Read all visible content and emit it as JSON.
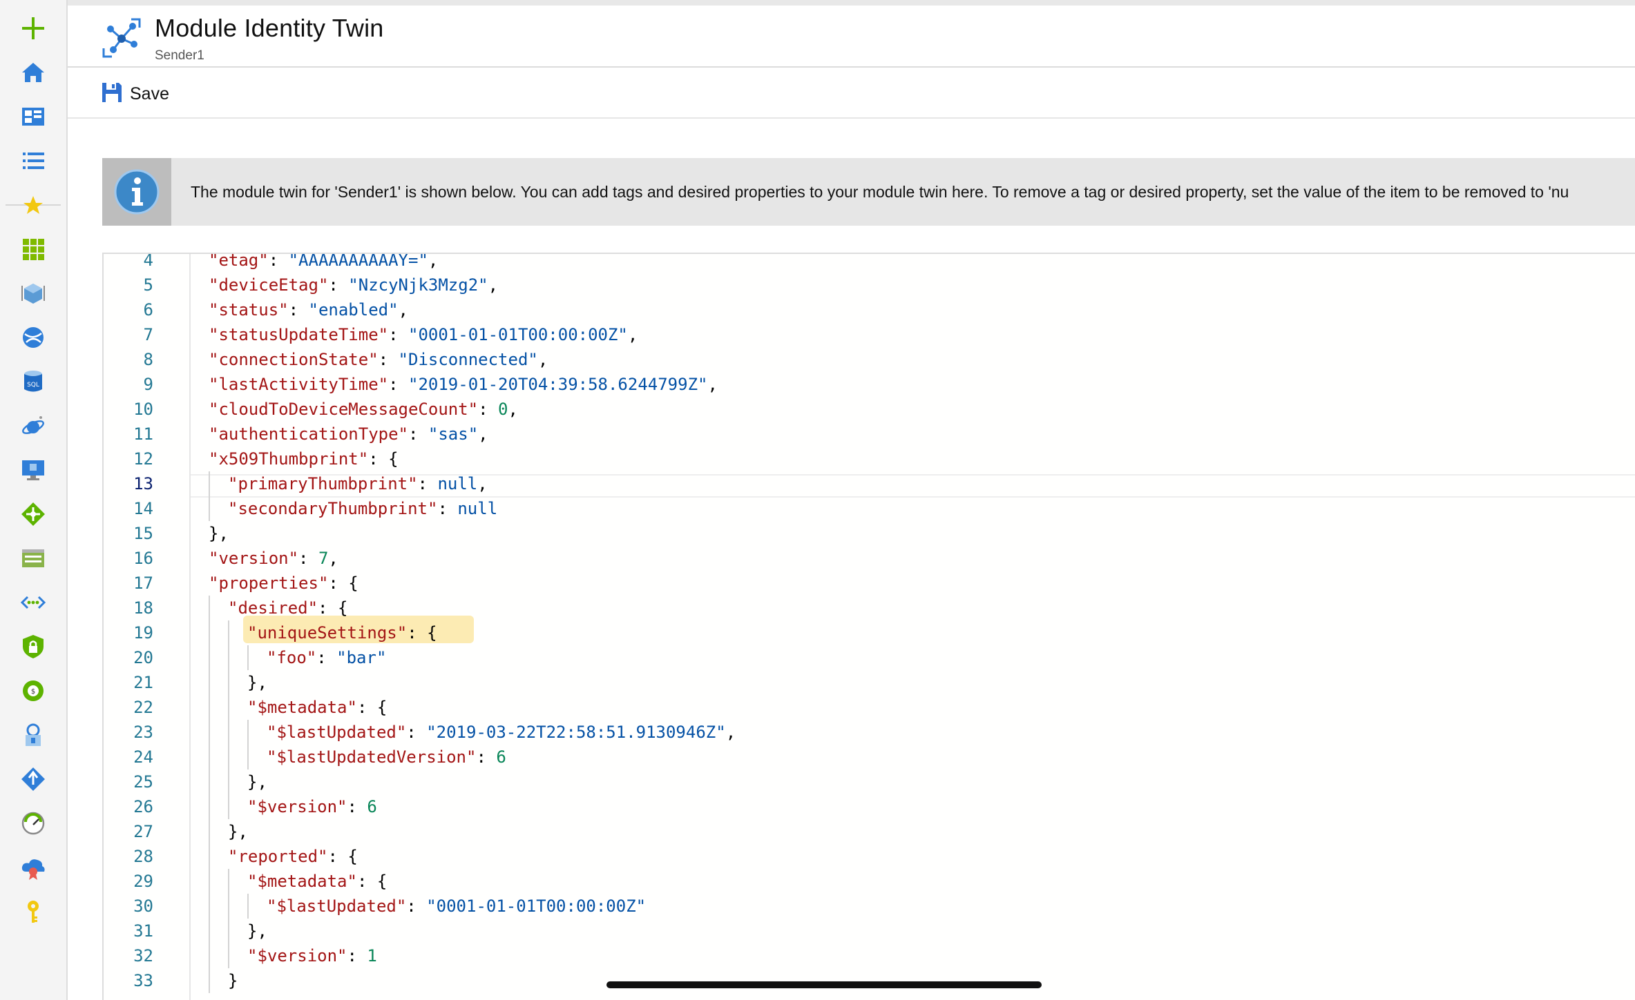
{
  "header": {
    "title": "Module Identity Twin",
    "subtitle": "Sender1"
  },
  "toolbar": {
    "save_label": "Save"
  },
  "info_banner": {
    "text": "The module twin for 'Sender1' is shown below. You can add tags and desired properties to your module twin here. To remove a tag or desired property, set the value of the item to be removed to 'nu"
  },
  "nav_icons": [
    "create-resource-icon",
    "home-icon",
    "dashboard-icon",
    "all-services-icon",
    "favorites-star-icon",
    "all-resources-icon",
    "resource-groups-icon",
    "app-services-icon",
    "sql-database-icon",
    "cosmos-db-icon",
    "virtual-machines-icon",
    "load-balancers-icon",
    "storage-accounts-icon",
    "virtual-networks-icon",
    "security-center-icon",
    "cost-management-icon",
    "azure-ad-icon",
    "monitor-icon",
    "advisor-icon",
    "cloud-icon",
    "key-vault-icon"
  ],
  "editor": {
    "active_line": "13",
    "lines": [
      {
        "n": "4",
        "indent": 0,
        "tokens": [
          {
            "t": "\"etag\"",
            "c": "k"
          },
          {
            "t": ": ",
            "c": "p"
          },
          {
            "t": "\"AAAAAAAAAAY=\"",
            "c": "s"
          },
          {
            "t": ",",
            "c": "p"
          }
        ]
      },
      {
        "n": "5",
        "indent": 0,
        "tokens": [
          {
            "t": "\"deviceEtag\"",
            "c": "k"
          },
          {
            "t": ": ",
            "c": "p"
          },
          {
            "t": "\"NzcyNjk3Mzg2\"",
            "c": "s"
          },
          {
            "t": ",",
            "c": "p"
          }
        ]
      },
      {
        "n": "6",
        "indent": 0,
        "tokens": [
          {
            "t": "\"status\"",
            "c": "k"
          },
          {
            "t": ": ",
            "c": "p"
          },
          {
            "t": "\"enabled\"",
            "c": "s"
          },
          {
            "t": ",",
            "c": "p"
          }
        ]
      },
      {
        "n": "7",
        "indent": 0,
        "tokens": [
          {
            "t": "\"statusUpdateTime\"",
            "c": "k"
          },
          {
            "t": ": ",
            "c": "p"
          },
          {
            "t": "\"0001-01-01T00:00:00Z\"",
            "c": "s"
          },
          {
            "t": ",",
            "c": "p"
          }
        ]
      },
      {
        "n": "8",
        "indent": 0,
        "tokens": [
          {
            "t": "\"connectionState\"",
            "c": "k"
          },
          {
            "t": ": ",
            "c": "p"
          },
          {
            "t": "\"Disconnected\"",
            "c": "s"
          },
          {
            "t": ",",
            "c": "p"
          }
        ]
      },
      {
        "n": "9",
        "indent": 0,
        "tokens": [
          {
            "t": "\"lastActivityTime\"",
            "c": "k"
          },
          {
            "t": ": ",
            "c": "p"
          },
          {
            "t": "\"2019-01-20T04:39:58.6244799Z\"",
            "c": "s"
          },
          {
            "t": ",",
            "c": "p"
          }
        ]
      },
      {
        "n": "10",
        "indent": 0,
        "tokens": [
          {
            "t": "\"cloudToDeviceMessageCount\"",
            "c": "k"
          },
          {
            "t": ": ",
            "c": "p"
          },
          {
            "t": "0",
            "c": "n"
          },
          {
            "t": ",",
            "c": "p"
          }
        ]
      },
      {
        "n": "11",
        "indent": 0,
        "tokens": [
          {
            "t": "\"authenticationType\"",
            "c": "k"
          },
          {
            "t": ": ",
            "c": "p"
          },
          {
            "t": "\"sas\"",
            "c": "s"
          },
          {
            "t": ",",
            "c": "p"
          }
        ]
      },
      {
        "n": "12",
        "indent": 0,
        "tokens": [
          {
            "t": "\"x509Thumbprint\"",
            "c": "k"
          },
          {
            "t": ": {",
            "c": "p"
          }
        ]
      },
      {
        "n": "13",
        "indent": 1,
        "tokens": [
          {
            "t": "\"primaryThumbprint\"",
            "c": "k"
          },
          {
            "t": ": ",
            "c": "p"
          },
          {
            "t": "null",
            "c": "kw"
          },
          {
            "t": ",",
            "c": "p"
          }
        ]
      },
      {
        "n": "14",
        "indent": 1,
        "tokens": [
          {
            "t": "\"secondaryThumbprint\"",
            "c": "k"
          },
          {
            "t": ": ",
            "c": "p"
          },
          {
            "t": "null",
            "c": "kw"
          }
        ]
      },
      {
        "n": "15",
        "indent": 0,
        "tokens": [
          {
            "t": "},",
            "c": "p"
          }
        ]
      },
      {
        "n": "16",
        "indent": 0,
        "tokens": [
          {
            "t": "\"version\"",
            "c": "k"
          },
          {
            "t": ": ",
            "c": "p"
          },
          {
            "t": "7",
            "c": "n"
          },
          {
            "t": ",",
            "c": "p"
          }
        ]
      },
      {
        "n": "17",
        "indent": 0,
        "tokens": [
          {
            "t": "\"properties\"",
            "c": "k"
          },
          {
            "t": ": {",
            "c": "p"
          }
        ]
      },
      {
        "n": "18",
        "indent": 1,
        "tokens": [
          {
            "t": "\"desired\"",
            "c": "k"
          },
          {
            "t": ": {",
            "c": "p"
          }
        ]
      },
      {
        "n": "19",
        "indent": 2,
        "tokens": [
          {
            "t": "\"uniqueSettings\"",
            "c": "k"
          },
          {
            "t": ": {",
            "c": "p"
          }
        ]
      },
      {
        "n": "20",
        "indent": 3,
        "tokens": [
          {
            "t": "\"foo\"",
            "c": "k"
          },
          {
            "t": ": ",
            "c": "p"
          },
          {
            "t": "\"bar\"",
            "c": "s"
          }
        ]
      },
      {
        "n": "21",
        "indent": 2,
        "tokens": [
          {
            "t": "},",
            "c": "p"
          }
        ]
      },
      {
        "n": "22",
        "indent": 2,
        "tokens": [
          {
            "t": "\"$metadata\"",
            "c": "k"
          },
          {
            "t": ": {",
            "c": "p"
          }
        ]
      },
      {
        "n": "23",
        "indent": 3,
        "tokens": [
          {
            "t": "\"$lastUpdated\"",
            "c": "k"
          },
          {
            "t": ": ",
            "c": "p"
          },
          {
            "t": "\"2019-03-22T22:58:51.9130946Z\"",
            "c": "s"
          },
          {
            "t": ",",
            "c": "p"
          }
        ]
      },
      {
        "n": "24",
        "indent": 3,
        "tokens": [
          {
            "t": "\"$lastUpdatedVersion\"",
            "c": "k"
          },
          {
            "t": ": ",
            "c": "p"
          },
          {
            "t": "6",
            "c": "n"
          }
        ]
      },
      {
        "n": "25",
        "indent": 2,
        "tokens": [
          {
            "t": "},",
            "c": "p"
          }
        ]
      },
      {
        "n": "26",
        "indent": 2,
        "tokens": [
          {
            "t": "\"$version\"",
            "c": "k"
          },
          {
            "t": ": ",
            "c": "p"
          },
          {
            "t": "6",
            "c": "n"
          }
        ]
      },
      {
        "n": "27",
        "indent": 1,
        "tokens": [
          {
            "t": "},",
            "c": "p"
          }
        ]
      },
      {
        "n": "28",
        "indent": 1,
        "tokens": [
          {
            "t": "\"reported\"",
            "c": "k"
          },
          {
            "t": ": {",
            "c": "p"
          }
        ]
      },
      {
        "n": "29",
        "indent": 2,
        "tokens": [
          {
            "t": "\"$metadata\"",
            "c": "k"
          },
          {
            "t": ": {",
            "c": "p"
          }
        ]
      },
      {
        "n": "30",
        "indent": 3,
        "tokens": [
          {
            "t": "\"$lastUpdated\"",
            "c": "k"
          },
          {
            "t": ": ",
            "c": "p"
          },
          {
            "t": "\"0001-01-01T00:00:00Z\"",
            "c": "s"
          }
        ]
      },
      {
        "n": "31",
        "indent": 2,
        "tokens": [
          {
            "t": "},",
            "c": "p"
          }
        ]
      },
      {
        "n": "32",
        "indent": 2,
        "tokens": [
          {
            "t": "\"$version\"",
            "c": "k"
          },
          {
            "t": ": ",
            "c": "p"
          },
          {
            "t": "1",
            "c": "n"
          }
        ]
      },
      {
        "n": "33",
        "indent": 1,
        "tokens": [
          {
            "t": "}",
            "c": "p"
          }
        ]
      }
    ]
  },
  "colors": {
    "key": "#a31515",
    "string": "#0451a5",
    "number": "#098658",
    "accent": "#0078d4",
    "highlight": "#fbe7a6"
  }
}
